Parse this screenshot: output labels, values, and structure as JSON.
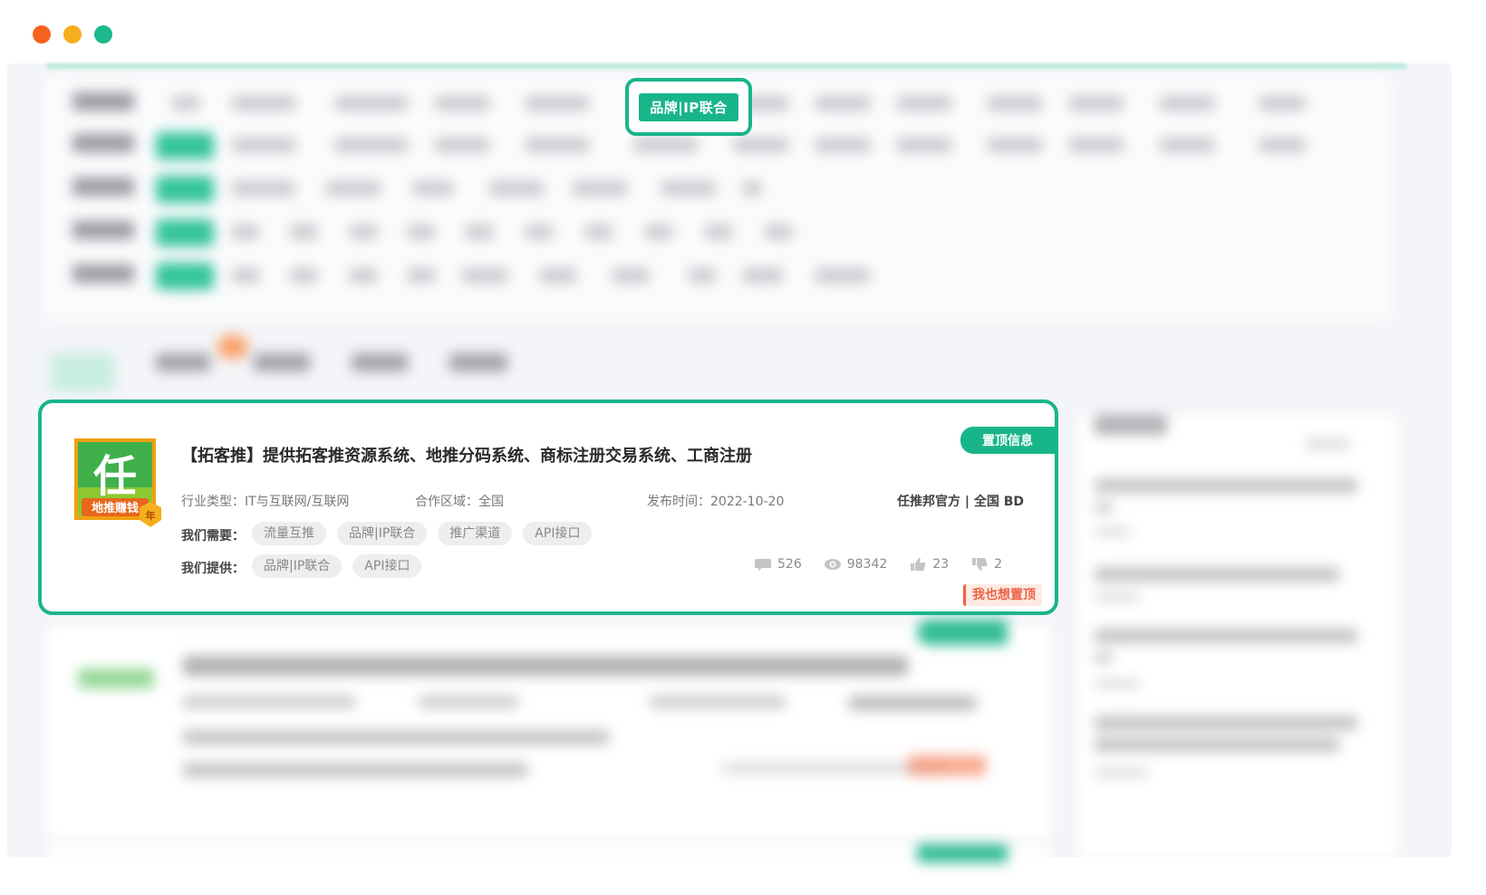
{
  "window": {
    "controls": [
      {
        "name": "close",
        "color": "#f5641d"
      },
      {
        "name": "minimize",
        "color": "#f6ae1e"
      },
      {
        "name": "maximize",
        "color": "#1bb98c"
      }
    ]
  },
  "highlight_filter_tag": "品牌|IP联合",
  "featured_card": {
    "title": "【拓客推】提供拓客推资源系统、地推分码系统、商标注册交易系统、工商注册",
    "badge": "置顶信息",
    "logo": {
      "char": "任",
      "subtitle": "地推赚钱",
      "seal": "年"
    },
    "industry_label": "行业类型：",
    "industry_value": "IT与互联网/互联网",
    "region_label": "合作区域：",
    "region_value": "全国",
    "date_label": "发布时间：",
    "date_value": "2022-10-20",
    "publisher": "任推邦官方 | 全国 BD",
    "needs_label": "我们需要：",
    "needs": [
      "流量互推",
      "品牌|IP联合",
      "推广渠道",
      "API接口"
    ],
    "offers_label": "我们提供：",
    "offers": [
      "品牌|IP联合",
      "API接口"
    ],
    "stats": {
      "comments": "526",
      "views": "98342",
      "likes": "23",
      "dislikes": "2"
    },
    "want_top": "我也想置顶"
  },
  "colors": {
    "accent": "#19b58a",
    "warning": "#ef6043"
  }
}
